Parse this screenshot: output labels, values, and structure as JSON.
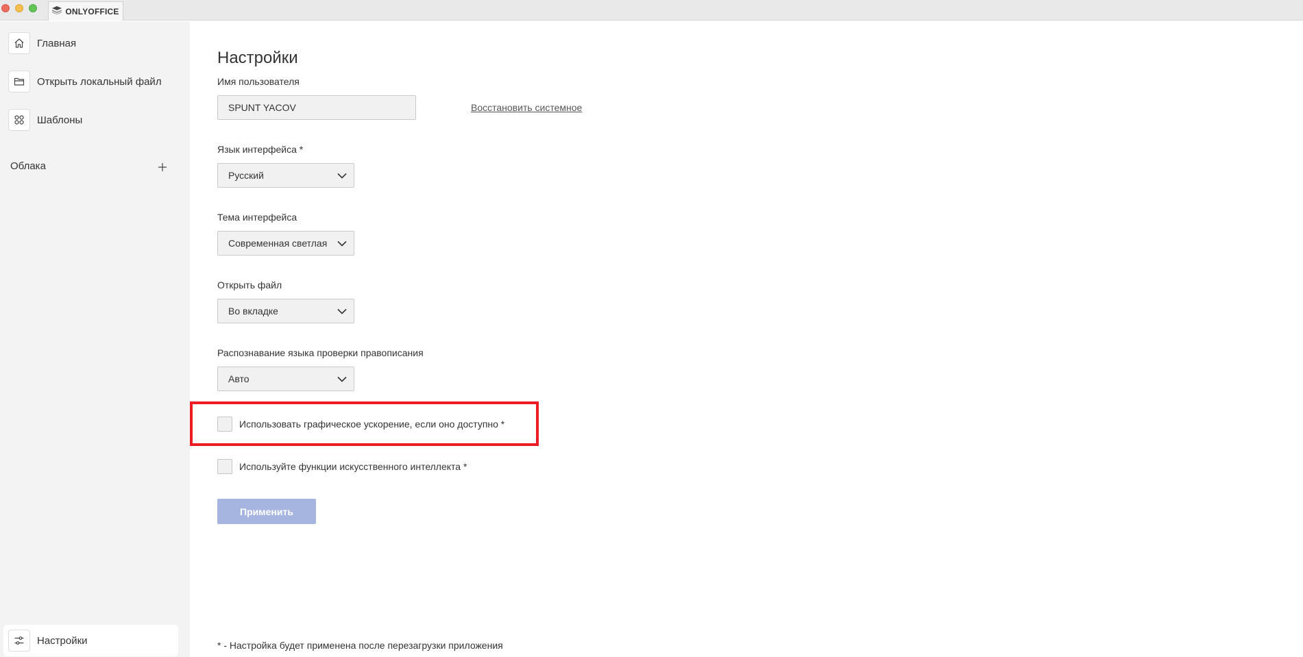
{
  "titlebar": {
    "app_tab_label": "ONLYOFFICE"
  },
  "sidebar": {
    "items": [
      {
        "label": "Главная",
        "icon": "home-icon"
      },
      {
        "label": "Открыть локальный файл",
        "icon": "folder-icon"
      },
      {
        "label": "Шаблоны",
        "icon": "templates-icon"
      }
    ],
    "clouds_title": "Облака",
    "settings_label": "Настройки"
  },
  "settings": {
    "title": "Настройки",
    "username": {
      "label": "Имя пользователя",
      "value": "SPUNT YACOV",
      "restore_link": "Восстановить системное"
    },
    "language": {
      "label": "Язык интерфейса *",
      "value": "Русский"
    },
    "theme": {
      "label": "Тема интерфейса",
      "value": "Современная светлая"
    },
    "open_file": {
      "label": "Открыть файл",
      "value": "Во вкладке"
    },
    "spellcheck": {
      "label": "Распознавание языка проверки правописания",
      "value": "Авто"
    },
    "gpu_accel": {
      "label": "Использовать графическое ускорение, если оно доступно *",
      "checked": false
    },
    "ai_features": {
      "label": "Используйте функции искусственного интеллекта *",
      "checked": false
    },
    "apply_label": "Применить",
    "footnote": "* - Настройка будет применена после перезагрузки приложения"
  },
  "colors": {
    "highlight": "#ee1b24",
    "apply_disabled": "#a6b4e0",
    "sidebar_bg": "#f3f3f3"
  }
}
